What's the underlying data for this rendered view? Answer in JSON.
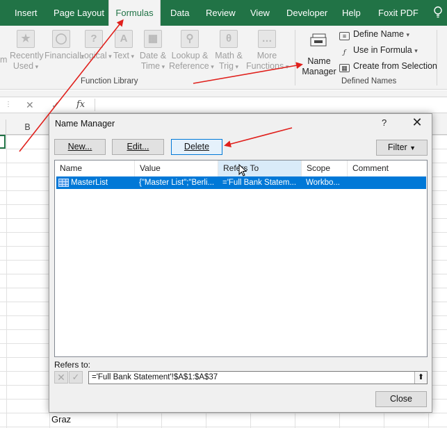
{
  "tabs": [
    "Insert",
    "Page Layout",
    "Formulas",
    "Data",
    "Review",
    "View",
    "Developer",
    "Help",
    "Foxit PDF"
  ],
  "active_tab": "Formulas",
  "ribbon": {
    "partial_label": "m",
    "function_library": {
      "buttons": [
        {
          "line1": "Recently",
          "line2": "Used",
          "icon": "star-icon"
        },
        {
          "line1": "Financial",
          "line2": "",
          "icon": "coins-icon"
        },
        {
          "line1": "Logical",
          "line2": "",
          "icon": "question-icon"
        },
        {
          "line1": "Text",
          "line2": "",
          "icon": "text-a-icon"
        },
        {
          "line1": "Date &",
          "line2": "Time",
          "icon": "calendar-icon"
        },
        {
          "line1": "Lookup &",
          "line2": "Reference",
          "icon": "magnifier-icon"
        },
        {
          "line1": "Math &",
          "line2": "Trig",
          "icon": "theta-icon"
        },
        {
          "line1": "More",
          "line2": "Functions",
          "icon": "ellipsis-icon"
        }
      ],
      "label": "Function Library"
    },
    "defined_names": {
      "name_manager": {
        "line1": "Name",
        "line2": "Manager"
      },
      "items": [
        {
          "label": "Define Name",
          "icon": "tag-icon"
        },
        {
          "label": "Use in Formula",
          "icon": "fx-icon"
        },
        {
          "label": "Create from Selection",
          "icon": "grid-icon"
        }
      ],
      "label": "Defined Names"
    }
  },
  "formula_bar": {
    "fx": "fx"
  },
  "grid": {
    "column_b": "B",
    "cell_graz": "Graz"
  },
  "dialog": {
    "title": "Name Manager",
    "help": "?",
    "buttons": {
      "new": "New...",
      "edit": "Edit...",
      "delete": "Delete",
      "filter": "Filter"
    },
    "columns": [
      "Name",
      "Value",
      "Refers To",
      "Scope",
      "Comment"
    ],
    "rows": [
      {
        "name": "MasterList",
        "value": "{\"Master List\";\"Berli...",
        "refers_to": "='Full Bank Statem...",
        "scope": "Workbo...",
        "comment": ""
      }
    ],
    "refers_to_label": "Refers to:",
    "refers_to_value": "='Full Bank Statement'!$A$1:$A$37",
    "close": "Close"
  },
  "colors": {
    "excel_green": "#217346",
    "selection_blue": "#0078d7",
    "annotation_red": "#e0201c"
  }
}
